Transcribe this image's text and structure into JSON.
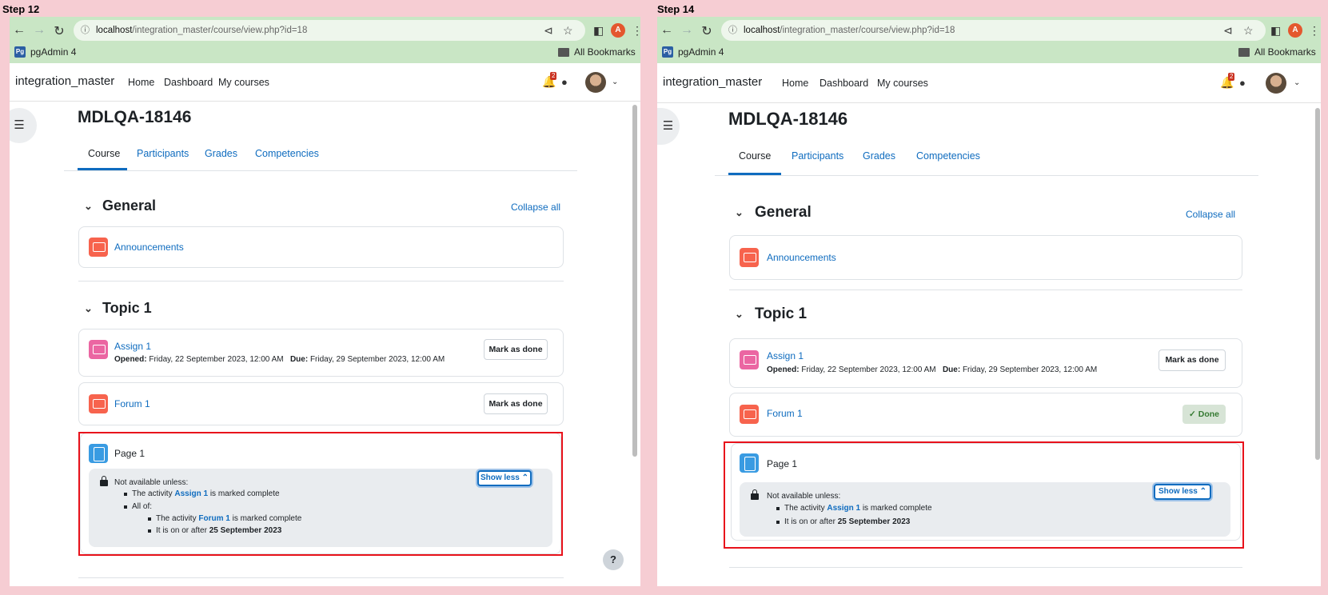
{
  "steps": [
    {
      "label": "Step 12"
    },
    {
      "label": "Step 14"
    }
  ],
  "browser": {
    "url_host": "localhost",
    "url_path": "/integration_master/course/view.php?id=18",
    "account_initial": "A",
    "bookmark_pgadmin": "pgAdmin 4",
    "bookmark_all": "All Bookmarks"
  },
  "site": {
    "brand": "integration_master",
    "nav": [
      "Home",
      "Dashboard",
      "My courses"
    ],
    "notification_count": "2"
  },
  "course": {
    "title": "MDLQA-18146",
    "tabs": [
      "Course",
      "Participants",
      "Grades",
      "Competencies"
    ],
    "collapse_all": "Collapse all",
    "section_general": "General",
    "section_topic": "Topic 1",
    "announcements": "Announcements",
    "assign": {
      "name": "Assign 1",
      "opened_label": "Opened:",
      "opened_value": "Friday, 22 September 2023, 12:00 AM",
      "due_label": "Due:",
      "due_value": "Friday, 29 September 2023, 12:00 AM"
    },
    "forum": {
      "name": "Forum 1"
    },
    "page": {
      "name": "Page 1"
    },
    "mark_as_done": "Mark as done",
    "done": "Done",
    "show_less": "Show less",
    "restrictions": {
      "not_available": "Not available unless:",
      "the_activity": "The activity",
      "is_marked_complete": "is marked complete",
      "assign_link": "Assign 1",
      "forum_link": "Forum 1",
      "all_of": "All of:",
      "on_or_after": "It is on or after",
      "date": "25 September 2023"
    }
  },
  "help": "?"
}
